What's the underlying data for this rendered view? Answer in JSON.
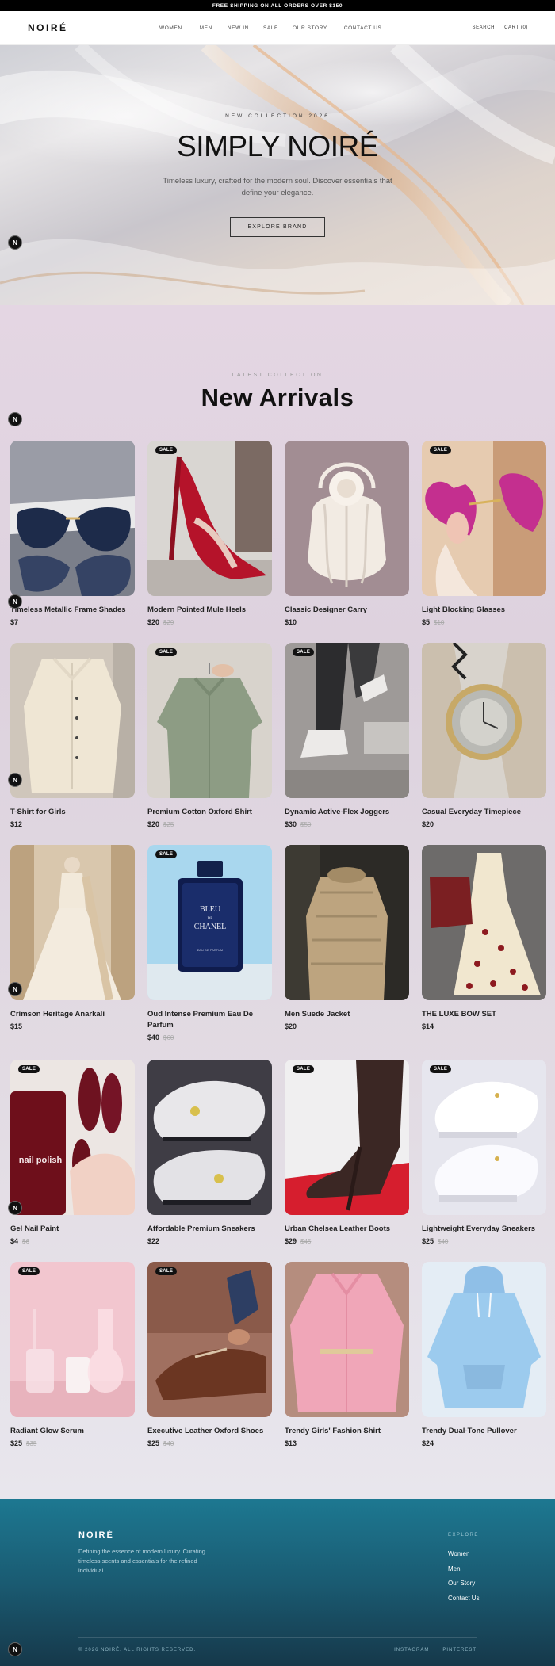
{
  "announcement": "FREE SHIPPING ON ALL ORDERS OVER $150",
  "header": {
    "logo": "NOIRÉ",
    "nav": [
      "WOMEN",
      "MEN",
      "NEW IN",
      "SALE",
      "OUR STORY",
      "CONTACT US"
    ],
    "search": "SEARCH",
    "cart": "CART (0)"
  },
  "hero": {
    "eyebrow": "NEW COLLECTION 2026",
    "title": "SIMPLY NOIRÉ",
    "subtitle": "Timeless luxury, crafted for the modern soul. Discover essentials that define your elegance.",
    "button": "EXPLORE BRAND"
  },
  "badge_letter": "N",
  "arrivals": {
    "eyebrow": "LATEST COLLECTION",
    "title": "New Arrivals",
    "sale_label": "SALE",
    "products": [
      {
        "name": "Timeless Metallic Frame Shades",
        "price": "$7",
        "old_price": "",
        "sale": false
      },
      {
        "name": "Modern Pointed Mule Heels",
        "price": "$20",
        "old_price": "$29",
        "sale": true
      },
      {
        "name": "Classic Designer Carry",
        "price": "$10",
        "old_price": "",
        "sale": false
      },
      {
        "name": "Light Blocking Glasses",
        "price": "$5",
        "old_price": "$10",
        "sale": true
      },
      {
        "name": "T-Shirt for Girls",
        "price": "$12",
        "old_price": "",
        "sale": false
      },
      {
        "name": "Premium Cotton Oxford Shirt",
        "price": "$20",
        "old_price": "$25",
        "sale": true
      },
      {
        "name": "Dynamic Active-Flex Joggers",
        "price": "$30",
        "old_price": "$50",
        "sale": true
      },
      {
        "name": "Casual Everyday Timepiece",
        "price": "$20",
        "old_price": "",
        "sale": false
      },
      {
        "name": "Crimson Heritage Anarkali",
        "price": "$15",
        "old_price": "",
        "sale": false
      },
      {
        "name": "Oud Intense Premium Eau De Parfum",
        "price": "$40",
        "old_price": "$60",
        "sale": true
      },
      {
        "name": "Men Suede Jacket",
        "price": "$20",
        "old_price": "",
        "sale": false
      },
      {
        "name": "THE LUXE BOW SET",
        "price": "$14",
        "old_price": "",
        "sale": false
      },
      {
        "name": "Gel Nail Paint",
        "price": "$4",
        "old_price": "$6",
        "sale": true
      },
      {
        "name": "Affordable Premium Sneakers",
        "price": "$22",
        "old_price": "",
        "sale": false
      },
      {
        "name": "Urban Chelsea Leather Boots",
        "price": "$29",
        "old_price": "$45",
        "sale": true
      },
      {
        "name": "Lightweight Everyday Sneakers",
        "price": "$25",
        "old_price": "$40",
        "sale": true
      },
      {
        "name": "Radiant Glow Serum",
        "price": "$25",
        "old_price": "$35",
        "sale": true
      },
      {
        "name": "Executive Leather Oxford Shoes",
        "price": "$25",
        "old_price": "$40",
        "sale": true
      },
      {
        "name": "Trendy Girls' Fashion Shirt",
        "price": "$13",
        "old_price": "",
        "sale": false
      },
      {
        "name": "Trendy Dual-Tone Pullover",
        "price": "$24",
        "old_price": "",
        "sale": false
      }
    ],
    "image_text": {
      "perfume_line1": "BLEU",
      "perfume_line2": "DE",
      "perfume_line3": "CHANEL",
      "perfume_line4": "EAU DE PARFUM",
      "nail_bottle": "nail polish"
    }
  },
  "footer": {
    "logo": "NOIRÉ",
    "description": "Defining the essence of modern luxury. Curating timeless scents and essentials for the refined individual.",
    "explore_heading": "EXPLORE",
    "links": [
      "Women",
      "Men",
      "Our Story",
      "Contact Us"
    ],
    "copyright": "© 2026 NOIRÉ. ALL RIGHTS RESERVED.",
    "social": [
      "INSTAGRAM",
      "PINTEREST"
    ]
  }
}
